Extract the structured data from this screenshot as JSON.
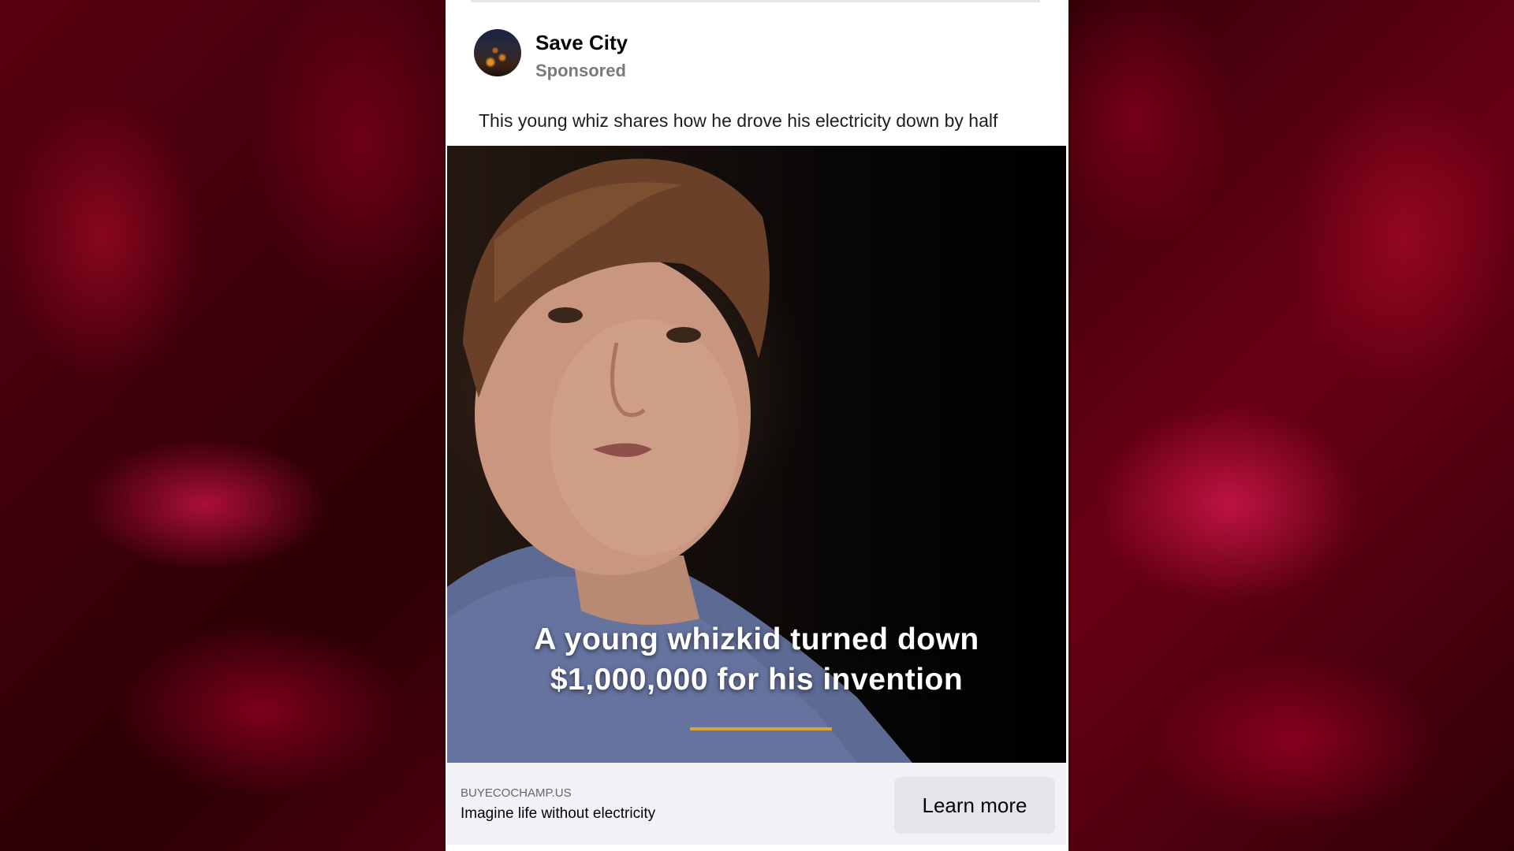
{
  "post": {
    "page_name": "Save City",
    "sponsored_label": "Sponsored",
    "caption": "This young whiz shares how he drove his electricity down by half"
  },
  "media": {
    "overlay_line1": "A young whizkid turned down",
    "overlay_line2": "$1,000,000 for his invention",
    "progress_fraction": 1.0,
    "accent_color": "#d9a436"
  },
  "link_footer": {
    "domain": "BUYECOCHAMP.US",
    "headline": "Imagine life without electricity",
    "cta_label": "Learn more"
  },
  "icons": {
    "avatar": "city-skyline-avatar"
  }
}
